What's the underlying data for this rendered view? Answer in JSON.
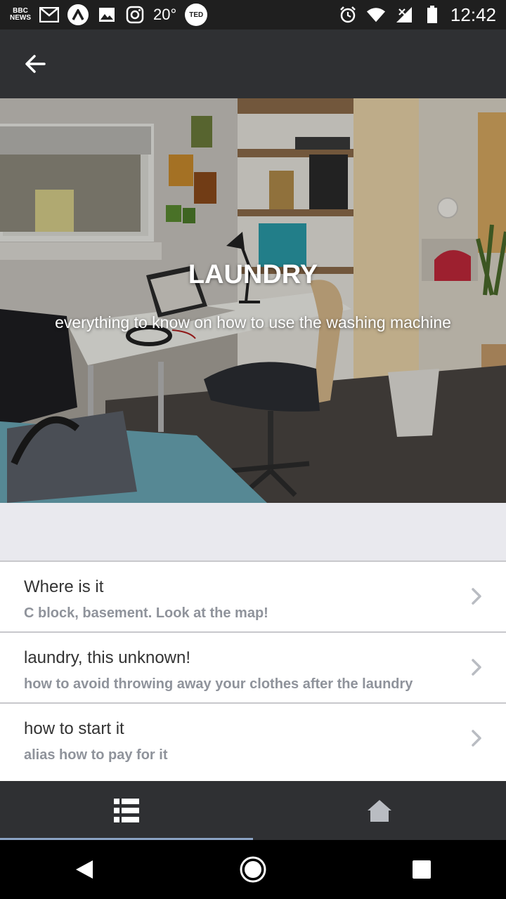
{
  "status_bar": {
    "bbc_label": "BBC NEWS",
    "temperature": "20°",
    "ted_label": "TED",
    "time": "12:42"
  },
  "header": {
    "back_icon": "arrow-left-icon"
  },
  "hero": {
    "title": "LAUNDRY",
    "subtitle": "everything to know on how to use the washing machine"
  },
  "list": {
    "items": [
      {
        "title": "Where is it",
        "subtitle": "C block, basement. Look at the map!"
      },
      {
        "title": "laundry, this unknown!",
        "subtitle": "how to avoid throwing away your clothes after the laundry"
      },
      {
        "title": "how to start it",
        "subtitle": "alias how to pay for it"
      }
    ]
  },
  "tabs": [
    {
      "icon": "list-icon",
      "active": true
    },
    {
      "icon": "home-icon",
      "active": false
    }
  ],
  "colors": {
    "app_bar": "#2f3033",
    "tab_indicator": "#8ba3c4",
    "subtitle_gray": "#8f939b"
  }
}
